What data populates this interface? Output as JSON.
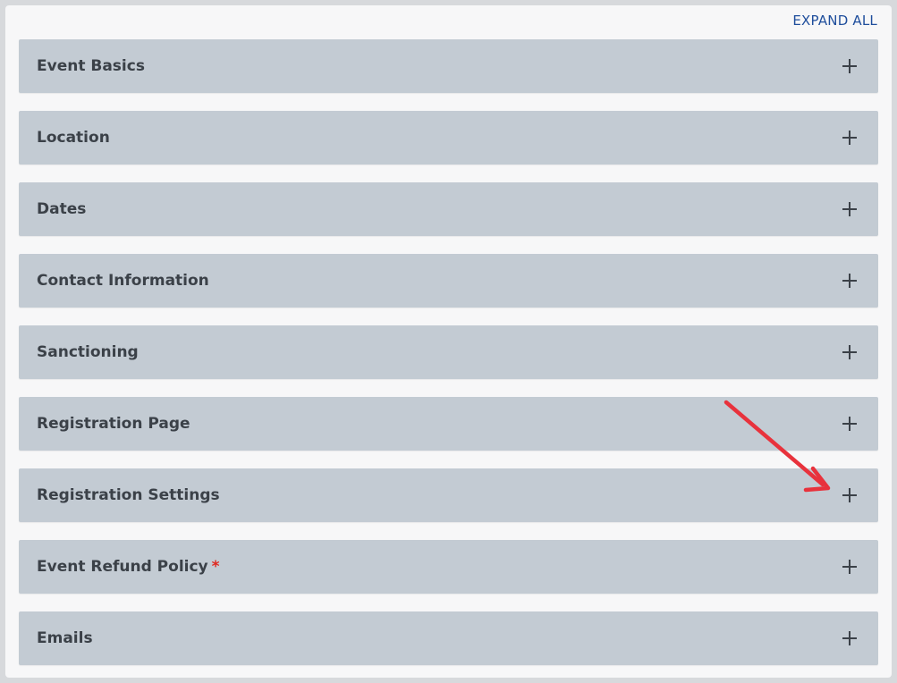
{
  "header": {
    "expand_all_label": "EXPAND ALL"
  },
  "sections": [
    {
      "label": "Event Basics",
      "required": "",
      "icon": "plus-icon"
    },
    {
      "label": "Location",
      "required": "",
      "icon": "plus-icon"
    },
    {
      "label": "Dates",
      "required": "",
      "icon": "plus-icon"
    },
    {
      "label": "Contact Information",
      "required": "",
      "icon": "plus-icon"
    },
    {
      "label": "Sanctioning",
      "required": "",
      "icon": "plus-icon"
    },
    {
      "label": "Registration Page",
      "required": "",
      "icon": "plus-icon"
    },
    {
      "label": "Registration Settings",
      "required": "",
      "icon": "plus-icon"
    },
    {
      "label": "Event Refund Policy",
      "required": "*",
      "icon": "plus-icon"
    },
    {
      "label": "Emails",
      "required": "",
      "icon": "plus-icon"
    }
  ],
  "annotation": {
    "arrow_color": "#e8323c"
  },
  "colors": {
    "accent": "#1f4e9c",
    "section_bg": "#c3cbd3",
    "panel_bg": "#f7f7f8",
    "text": "#3b4148",
    "required": "#e0281f"
  }
}
